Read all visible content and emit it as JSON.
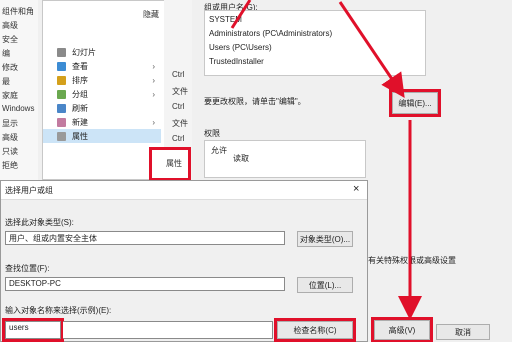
{
  "left_strip": {
    "lines": [
      "组件和角",
      "高级",
      "安全",
      "编",
      "修改",
      "最",
      "家庭",
      "Windows",
      "显示",
      "高级",
      "只读",
      "拒绝"
    ]
  },
  "context_menu": {
    "header": "隐藏",
    "items": [
      {
        "label": "幻灯片",
        "icon_color": "#8a8a8a",
        "has_arrow": false
      },
      {
        "label": "查看",
        "icon_color": "#3c8cd4",
        "has_arrow": true
      },
      {
        "label": "排序",
        "icon_color": "#d4a01c",
        "has_arrow": true
      },
      {
        "label": "分组",
        "icon_color": "#6aa84f",
        "has_arrow": true
      },
      {
        "label": "刷新",
        "icon_color": "#4a86c8",
        "has_arrow": false
      },
      {
        "label": "新建",
        "icon_color": "#c27ba0",
        "has_arrow": true
      },
      {
        "label": "属性",
        "icon_color": "#9a9a9a",
        "has_arrow": false
      }
    ]
  },
  "column_labels": [
    "Ctrl",
    "文件",
    "Ctrl",
    "文件",
    "Ctrl"
  ],
  "column_highlight": "属性",
  "perm_panel": {
    "title": "组或用户名(G):",
    "users": [
      "SYSTEM",
      "Administrators (PC\\Administrators)",
      "Users (PC\\Users)",
      "TrustedInstaller"
    ],
    "edit_note": "要更改权限，请单击\"编辑\"。",
    "edit_button": "编辑(E)...",
    "perm_label": "权限",
    "perm_rows": [
      "允许",
      "读取"
    ],
    "special_note": "有关特殊权限或高级设置",
    "advanced_button": "高级(V)",
    "cancel_button": "取消"
  },
  "dialog": {
    "title": "选择用户或组",
    "object_type_label": "选择此对象类型(S):",
    "object_type_value": "用户、组或内置安全主体",
    "object_type_button": "对象类型(O)...",
    "location_label": "查找位置(F):",
    "location_value": "DESKTOP-PC",
    "location_button": "位置(L)...",
    "names_label": "输入对象名称来选择(示例)(E):",
    "names_value": "users",
    "check_button": "检查名称(C)",
    "close_icon": "×"
  },
  "colors": {
    "highlight": "#e0102a",
    "accent": "#3c8cd4"
  }
}
